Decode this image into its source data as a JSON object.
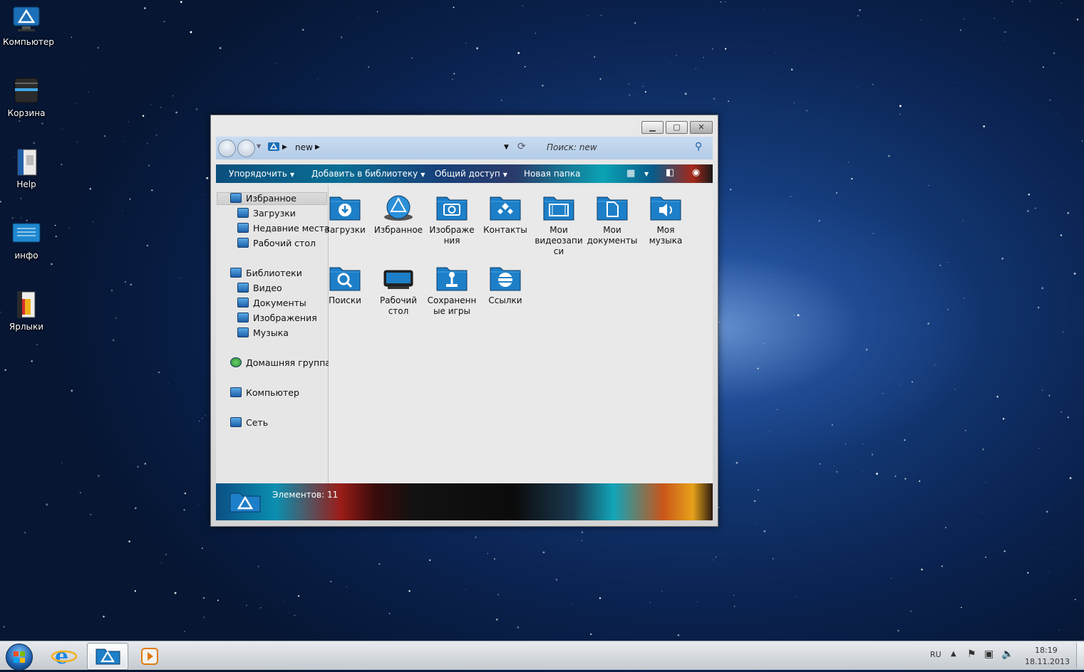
{
  "desktop": {
    "icons": [
      {
        "label": "Компьютер"
      },
      {
        "label": "Корзина"
      },
      {
        "label": "Help"
      },
      {
        "label": "инфо"
      },
      {
        "label": "Ярлыки"
      }
    ]
  },
  "explorer": {
    "address": {
      "folder": "new"
    },
    "search": {
      "placeholder": "Поиск: new"
    },
    "toolbar": {
      "organize": "Упорядочить",
      "add_to_library": "Добавить в библиотеку",
      "share": "Общий доступ",
      "new_folder": "Новая папка"
    },
    "sidebar": {
      "favorites": "Избранное",
      "downloads": "Загрузки",
      "recent": "Недавние места",
      "desktop": "Рабочий стол",
      "libraries": "Библиотеки",
      "video": "Видео",
      "documents": "Документы",
      "pictures": "Изображения",
      "music": "Музыка",
      "homegroup": "Домашняя группа",
      "computer": "Компьютер",
      "network": "Сеть"
    },
    "items": [
      {
        "label": "Загрузки",
        "icon": "download-arrow-icon"
      },
      {
        "label": "Избранное",
        "icon": "globe-icon"
      },
      {
        "label": "Изображе ния",
        "icon": "camera-icon"
      },
      {
        "label": "Контакты",
        "icon": "contacts-icon"
      },
      {
        "label": "Мои видеозапи си",
        "icon": "film-icon"
      },
      {
        "label": "Мои документы",
        "icon": "document-icon"
      },
      {
        "label": "Моя музыка",
        "icon": "speaker-icon"
      },
      {
        "label": "Поиски",
        "icon": "magnifier-icon"
      },
      {
        "label": "Рабочий стол",
        "icon": "monitor-icon"
      },
      {
        "label": "Сохраненн ые игры",
        "icon": "joystick-icon"
      },
      {
        "label": "Ссылки",
        "icon": "links-icon"
      }
    ],
    "status": "Элементов: 11"
  },
  "tray": {
    "lang": "RU",
    "time": "18:19",
    "date": "18.11.2013"
  }
}
